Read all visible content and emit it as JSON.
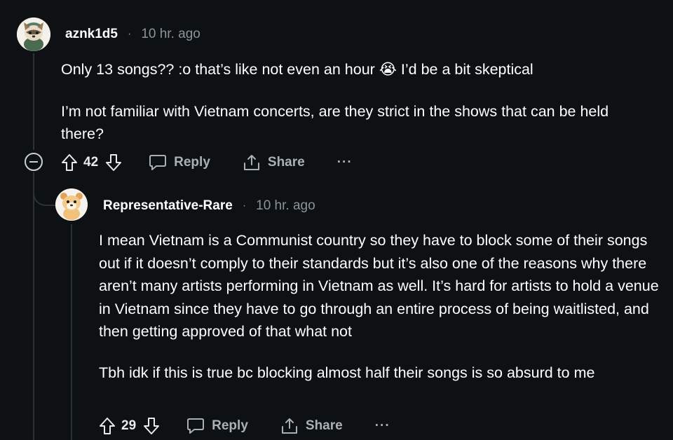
{
  "comments": [
    {
      "username": "aznk1d5",
      "separator": "·",
      "time": "10 hr. ago",
      "paragraphs": [
        "Only 13 songs?? :o that’s like not even an hour 😭 I’d be a bit skeptical",
        "I’m not familiar with Vietnam concerts, are they strict in the shows that can be held there?"
      ],
      "score": "42",
      "reply_label": "Reply",
      "share_label": "Share",
      "more_label": "···"
    },
    {
      "username": "Representative-Rare",
      "separator": "·",
      "time": "10 hr. ago",
      "paragraphs": [
        "I mean Vietnam is a Communist country so they have to block some of their songs out if it doesn’t comply to their standards but it’s also one of the reasons why there aren’t many artists performing in Vietnam as well. It’s hard for artists to hold a venue in Vietnam since they have to go through an entire process of being waitlisted, and then getting approved of that what not",
        "Tbh idk if this is true bc blocking almost half their songs is so absurd to me"
      ],
      "score": "29",
      "reply_label": "Reply",
      "share_label": "Share",
      "more_label": "···"
    }
  ],
  "colors": {
    "background": "#0e1113",
    "text": "#ffffff",
    "muted": "#8b9499",
    "thread_line": "#2a3236"
  },
  "icons": [
    "upvote-icon",
    "downvote-icon",
    "reply-bubble-icon",
    "share-icon",
    "collapse-icon",
    "more-icon"
  ]
}
